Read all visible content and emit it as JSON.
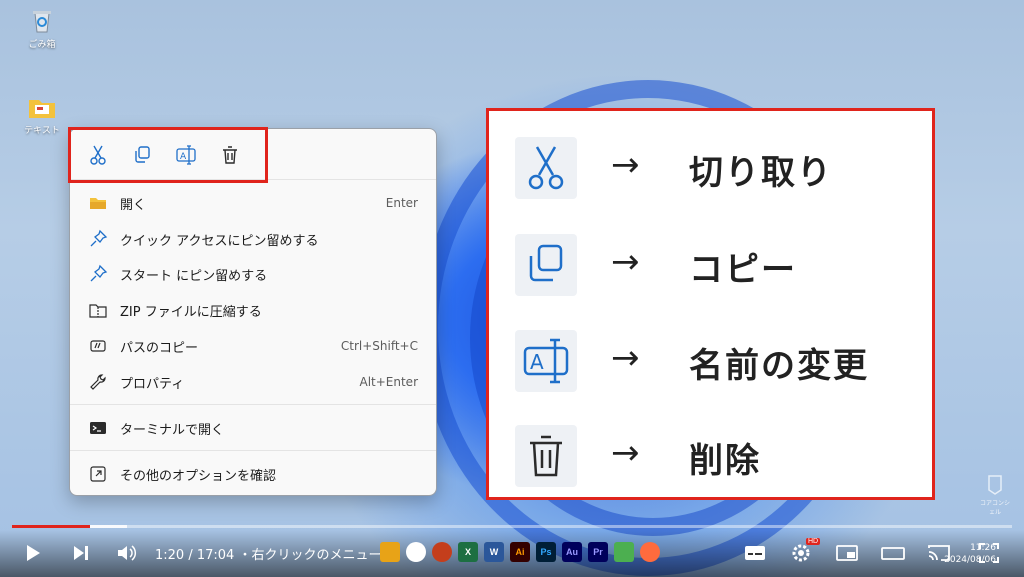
{
  "desktop": {
    "icons": [
      {
        "label": "ごみ箱",
        "icon": "recycle-bin-icon"
      },
      {
        "label": "テキスト",
        "icon": "folder-icon"
      }
    ]
  },
  "context_menu": {
    "quick_actions": [
      {
        "name": "cut",
        "icon": "scissors-icon"
      },
      {
        "name": "copy",
        "icon": "copy-icon"
      },
      {
        "name": "rename",
        "icon": "rename-icon"
      },
      {
        "name": "delete",
        "icon": "trash-icon"
      }
    ],
    "items": [
      {
        "label": "開く",
        "shortcut": "Enter",
        "icon": "folder-open-icon"
      },
      {
        "label": "クイック アクセスにピン留めする",
        "shortcut": "",
        "icon": "pin-icon"
      },
      {
        "label": "スタート にピン留めする",
        "shortcut": "",
        "icon": "pin-icon"
      },
      {
        "label": "ZIP ファイルに圧縮する",
        "shortcut": "",
        "icon": "zip-icon"
      },
      {
        "label": "パスのコピー",
        "shortcut": "Ctrl+Shift+C",
        "icon": "path-copy-icon"
      },
      {
        "label": "プロパティ",
        "shortcut": "Alt+Enter",
        "icon": "wrench-icon"
      },
      {
        "label": "ターミナルで開く",
        "shortcut": "",
        "icon": "terminal-icon"
      },
      {
        "label": "その他のオプションを確認",
        "shortcut": "",
        "icon": "more-options-icon"
      }
    ]
  },
  "explanation": {
    "arrow": "→",
    "rows": [
      {
        "label": "切り取り",
        "icon": "scissors-icon"
      },
      {
        "label": "コピー",
        "icon": "copy-icon"
      },
      {
        "label": "名前の変更",
        "icon": "rename-icon"
      },
      {
        "label": "削除",
        "icon": "trash-icon"
      }
    ]
  },
  "player": {
    "time": "1:20 / 17:04",
    "chapter": "・右クリックのメニュー",
    "chapter_chevron": ">",
    "hd_badge": "HD",
    "progress": 0.078,
    "buffered": 0.115
  },
  "taskbar": {
    "apps": [
      {
        "name": "X",
        "color": "#1d6f42"
      },
      {
        "name": "W",
        "color": "#2b579a"
      },
      {
        "name": "Ai",
        "color": "#330000"
      },
      {
        "name": "Ps",
        "color": "#001e36"
      },
      {
        "name": "Au",
        "color": "#00005b"
      },
      {
        "name": "Pr",
        "color": "#00005b"
      }
    ],
    "clock_time": "11:26",
    "clock_date": "2024/08/06"
  },
  "watermark": {
    "text": "コアコンシェル"
  },
  "colors": {
    "accent_red": "#e0241c",
    "icon_blue": "#1f6fc9"
  }
}
